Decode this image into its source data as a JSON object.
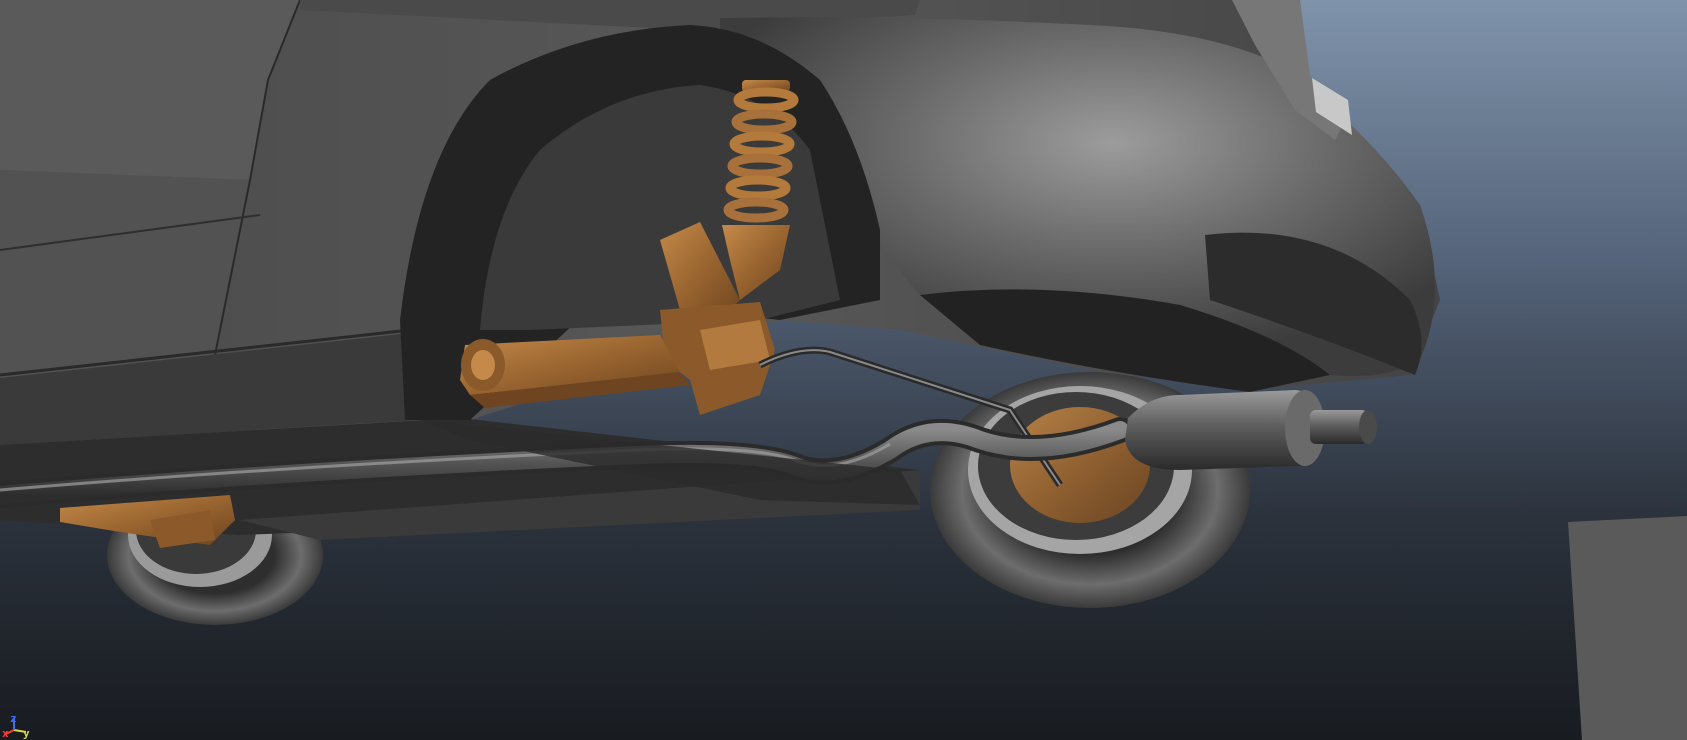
{
  "viewport": {
    "axis_gizmo": {
      "x_label": "x",
      "y_label": "y",
      "z_label": "z",
      "x_color": "#ff3b30",
      "y_color": "#d8d84a",
      "z_color": "#3a6cff"
    },
    "background": {
      "top_color": "#7f93aa",
      "bottom_color": "#181b20"
    },
    "scene_objects": [
      "car-body",
      "front-wheel",
      "rear-wheel",
      "coil-spring",
      "control-arm",
      "exhaust-pipe",
      "muffler",
      "ground-plane-block"
    ]
  }
}
